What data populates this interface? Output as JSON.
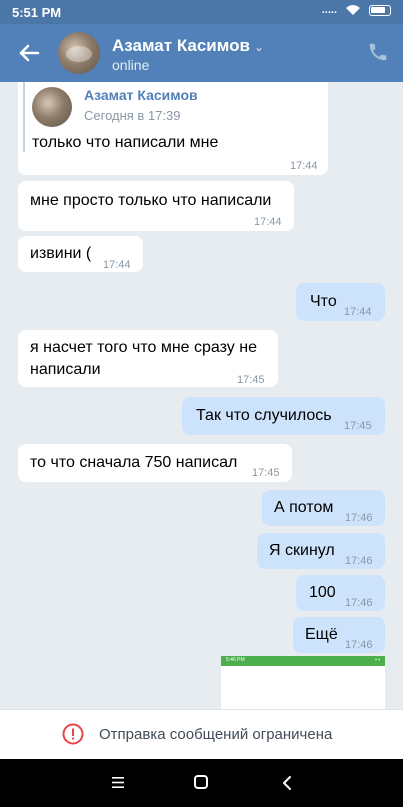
{
  "status_bar": {
    "time": "5:51 PM",
    "signal": "....."
  },
  "header": {
    "name": "Азамат Касимов",
    "status": "online"
  },
  "quote": {
    "name": "Азамат Касимов",
    "date": "Сегодня в 17:39"
  },
  "messages": [
    {
      "dir": "in",
      "text": "только что написали мне",
      "time": "17:44"
    },
    {
      "dir": "in",
      "text": "мне просто только что написали",
      "time": "17:44"
    },
    {
      "dir": "in",
      "text": "извини (",
      "time": "17:44"
    },
    {
      "dir": "out",
      "text": "Что",
      "time": "17:44"
    },
    {
      "dir": "in",
      "line1": "я насчет того что мне сразу не",
      "line2": "написали",
      "time": "17:45"
    },
    {
      "dir": "out",
      "text": "Так что случилось",
      "time": "17:45"
    },
    {
      "dir": "in",
      "text": "то что сначала 750 написал",
      "time": "17:45"
    },
    {
      "dir": "out",
      "text": "А потом",
      "time": "17:46"
    },
    {
      "dir": "out",
      "text": "Я скинул",
      "time": "17:46"
    },
    {
      "dir": "out",
      "text": "100",
      "time": "17:46"
    },
    {
      "dir": "out",
      "text": "Ещё",
      "time": "17:46"
    }
  ],
  "image_preview": {
    "time": "5:46 PM"
  },
  "restriction": {
    "text": "Отправка сообщений ограничена"
  },
  "colors": {
    "header": "#5181b8",
    "outgoing": "#cce3fb",
    "incoming": "#ffffff",
    "background": "#e7ecf1"
  }
}
